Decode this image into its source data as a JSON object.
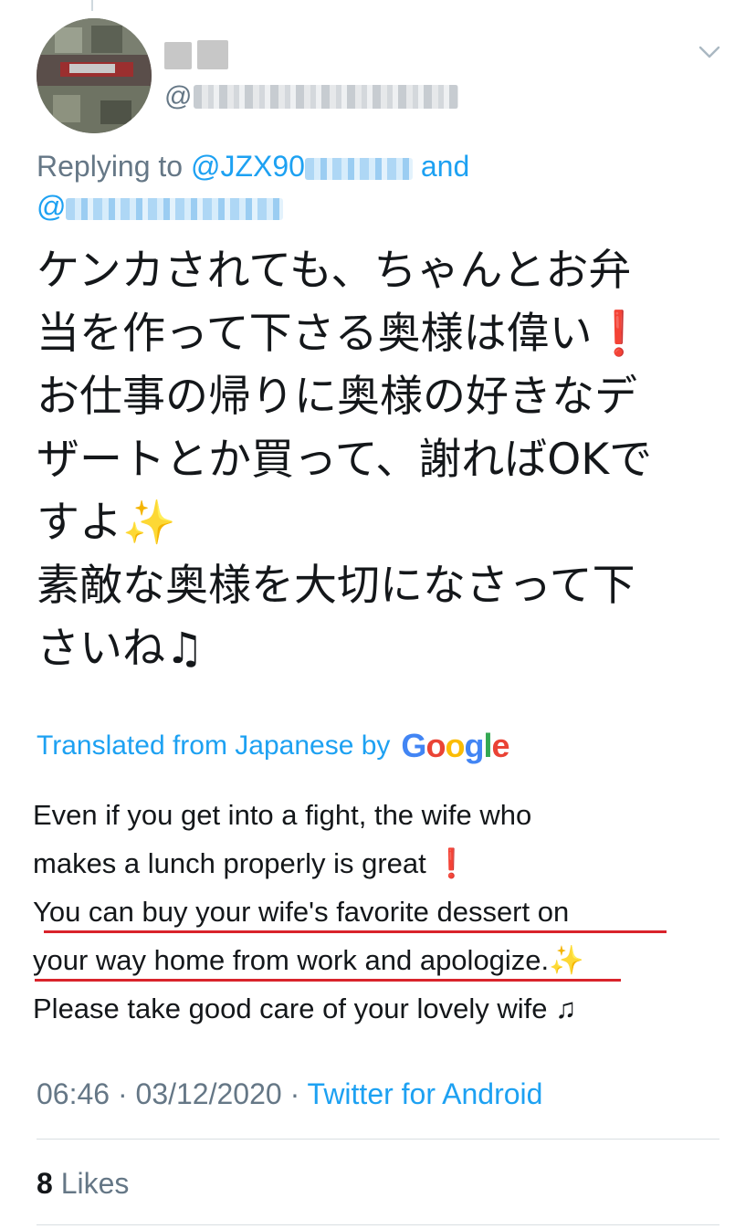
{
  "tweet": {
    "handle_prefix": "@",
    "replying_to": {
      "label": "Replying to",
      "first": "@JZX90",
      "and": "and",
      "second": "@"
    },
    "body_jp": [
      "ケンカされても、ちゃんとお弁",
      "当を作って下さる奥様は偉い",
      "お仕事の帰りに奥様の好きなデ",
      "ザートとか買って、謝ればOKで",
      "すよ",
      "素敵な奥様を大切になさって下",
      "さいね"
    ],
    "emoji": {
      "exclamation": "❗",
      "sparkles": "✨",
      "notes": "♫"
    },
    "translation": {
      "label": "Translated from Japanese by",
      "provider": [
        "G",
        "o",
        "o",
        "g",
        "l",
        "e"
      ],
      "lines": [
        "Even if you get into a fight, the wife who",
        "makes a lunch properly is great",
        " You can buy your wife's favorite dessert on",
        "your way home from work and apologize.",
        " Please take good care of your lovely wife "
      ]
    },
    "timestamp": "06:46 · 03/12/2020 · ",
    "source": "Twitter for Android",
    "likes_count": "8",
    "likes_label": "Likes"
  },
  "colors": {
    "link": "#1da1f2",
    "secondary": "#657786",
    "underline": "#d9232b",
    "google": [
      "#4285f4",
      "#ea4335",
      "#fbbc05",
      "#4285f4",
      "#34a853",
      "#ea4335"
    ]
  },
  "icons": {
    "menu": "chevron-down-icon"
  }
}
